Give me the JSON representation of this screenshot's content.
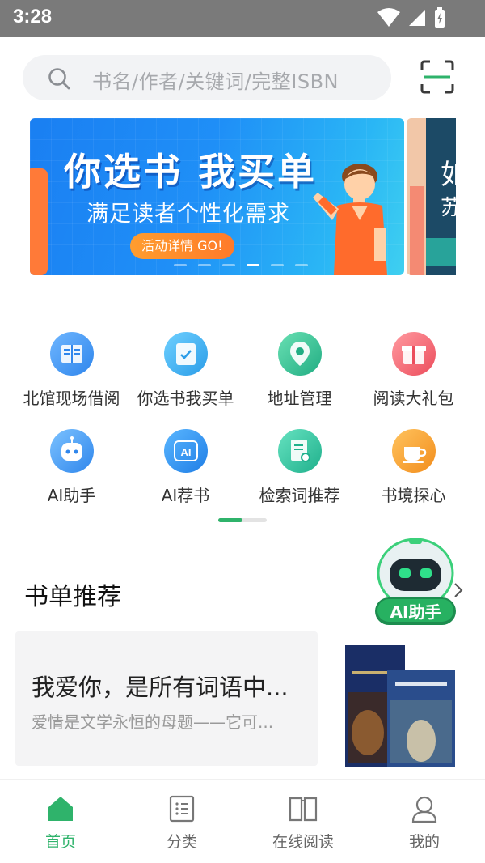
{
  "status_bar": {
    "time": "3:28"
  },
  "search": {
    "placeholder": "书名/作者/关键词/完整ISBN"
  },
  "banner": {
    "title": "你选书  我买单",
    "subtitle": "满足读者个性化需求",
    "cta": "活动详情 GO!",
    "next_banner_text_1": "如",
    "next_banner_text_2": "苏"
  },
  "menu": {
    "items": [
      {
        "label": "北馆现场借阅",
        "icon": "book-stand-icon",
        "color": "#3b94ee"
      },
      {
        "label": "你选书我买单",
        "icon": "book-check-icon",
        "color": "#2fa6ec"
      },
      {
        "label": "地址管理",
        "icon": "location-pin-icon",
        "color": "#2cbc8f"
      },
      {
        "label": "阅读大礼包",
        "icon": "gift-icon",
        "color": "#f05d68"
      },
      {
        "label": "AI助手",
        "icon": "robot-icon",
        "color": "#3a8ff0"
      },
      {
        "label": "AI荐书",
        "icon": "ai-badge-icon",
        "color": "#2a8be8"
      },
      {
        "label": "检索词推荐",
        "icon": "document-search-icon",
        "color": "#2bbd9a"
      },
      {
        "label": "书境探心",
        "icon": "coffee-cup-icon",
        "color": "#f6a12a"
      }
    ]
  },
  "book_list": {
    "title": "书单推荐",
    "more": "查看更多",
    "ai_badge": "AI助手",
    "card": {
      "title": "我爱你，是所有词语中...",
      "desc": "爱情是文学永恒的母题——它可..."
    }
  },
  "tabbar": {
    "tabs": [
      {
        "label": "首页",
        "icon": "home-icon",
        "active": true
      },
      {
        "label": "分类",
        "icon": "category-list-icon",
        "active": false
      },
      {
        "label": "在线阅读",
        "icon": "open-book-icon",
        "active": false
      },
      {
        "label": "我的",
        "icon": "user-icon",
        "active": false
      }
    ]
  },
  "colors": {
    "accent": "#2fb36b",
    "banner_blue": "#1f8ff7"
  }
}
